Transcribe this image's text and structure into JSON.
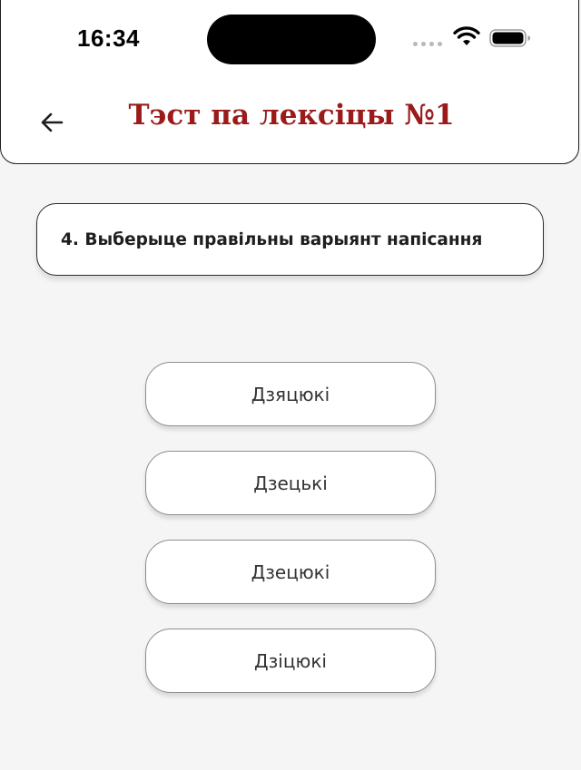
{
  "status_bar": {
    "time": "16:34"
  },
  "header": {
    "title": "Тэст па лексіцы №1"
  },
  "question": {
    "text": "4. Выберыце правільны варыянт напісання"
  },
  "options": [
    {
      "label": "Дзяцюкі"
    },
    {
      "label": "Дзецькі"
    },
    {
      "label": "Дзецюкі"
    },
    {
      "label": "Дзіцюкі"
    }
  ],
  "colors": {
    "title": "#9b1b1b",
    "background": "#f5f5f5"
  }
}
